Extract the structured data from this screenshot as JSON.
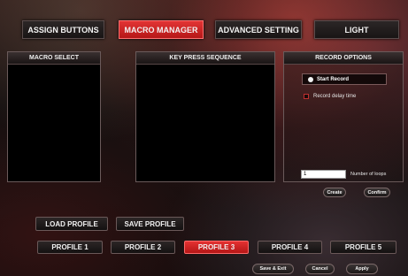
{
  "tabs": {
    "assign_buttons": "ASSIGN BUTTONS",
    "macro_manager": "MACRO MANAGER",
    "advanced_setting": "ADVANCED SETTING",
    "light": "LIGHT"
  },
  "macro_select": {
    "header": "MACRO SELECT"
  },
  "key_sequence": {
    "header": "KEY PRESS SEQUENCE"
  },
  "record_options": {
    "header": "RECORD OPTIONS",
    "start_record": "Start Record",
    "record_delay_time": "Record delay time",
    "loops_value": "1",
    "loops_label": "Number of loops",
    "create": "Create",
    "confirm": "Confirm"
  },
  "profile_actions": {
    "load": "LOAD PROFILE",
    "save": "SAVE PROFILE"
  },
  "profiles": [
    "PROFILE 1",
    "PROFILE 2",
    "PROFILE 3",
    "PROFILE 4",
    "PROFILE 5"
  ],
  "active_profile": "PROFILE 3",
  "footer": {
    "save_exit": "Save & Exit",
    "cancel": "Cancel",
    "apply": "Apply"
  },
  "colors": {
    "accent": "#d42424",
    "panel": "#000000"
  }
}
